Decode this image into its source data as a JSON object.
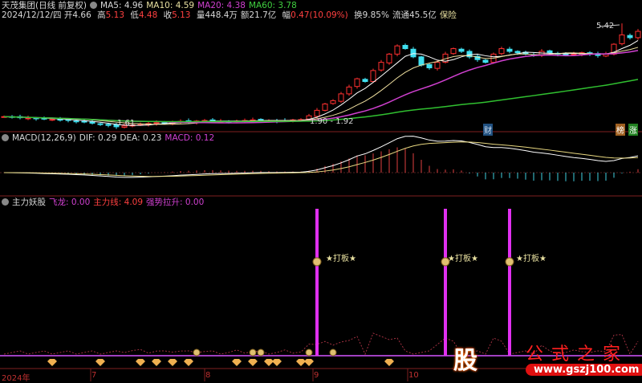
{
  "header": {
    "stock_name": "天茂集团(日线 前复权)",
    "ma5": "MA5: 4.96",
    "ma10": "MA10: 4.59",
    "ma20": "MA20: 4.38",
    "ma60": "MA60: 3.78",
    "date": "2024/12/12/四",
    "open_label": "开",
    "open": "4.66",
    "high_label": "高",
    "high": "5.13",
    "low_label": "低",
    "low": "4.48",
    "close_label": "收",
    "close": "5.13",
    "volume": "量448.4万",
    "amount": "额21.7亿",
    "change_label": "幅",
    "change": "0.47(10.09%)",
    "turnover": "换9.85%",
    "float": "流通45.5亿",
    "sector": "保险"
  },
  "macd_header": {
    "name": "MACD(12,26,9)",
    "dif": "DIF: 0.29",
    "dea": "DEA: 0.23",
    "macd": "MACD: 0.12"
  },
  "ind_header": {
    "name": "主力妖股",
    "feilong": "飞龙: 0.00",
    "zhuli": "主力线: 4.09",
    "qiangshi": "强势拉升: 0.00"
  },
  "labels": {
    "low_price": "1.61",
    "range": "1.90 - 1.92",
    "high_price": "5.42",
    "cai": "财",
    "bang": "榜",
    "zhang": "涨",
    "signal": "★打板★"
  },
  "xaxis": [
    "2024年",
    "7",
    "8",
    "9",
    "10"
  ],
  "logo": {
    "gu": "股",
    "name": "公式之家",
    "url": "www.gszj100.com"
  },
  "colors": {
    "up": "#ff3030",
    "down": "#40e0f0",
    "ma5": "#ffffff",
    "ma10": "#f0e0a0",
    "ma20": "#d040d0",
    "ma60": "#30c030",
    "signal": "#e030f0"
  },
  "chart_data": {
    "type": "candlestick",
    "title": "天茂集团(日线 前复权)",
    "closes": [
      2.02,
      2.0,
      1.98,
      1.97,
      1.95,
      1.93,
      1.92,
      1.9,
      1.88,
      1.85,
      1.82,
      1.78,
      1.74,
      1.7,
      1.65,
      1.68,
      1.72,
      1.75,
      1.77,
      1.8,
      1.78,
      1.82,
      1.85,
      1.83,
      1.86,
      1.88,
      1.87,
      1.85,
      1.84,
      1.86,
      1.88,
      1.9,
      1.89,
      1.87,
      1.86,
      1.88,
      1.9,
      1.91,
      2.05,
      2.25,
      2.48,
      2.6,
      2.85,
      3.1,
      3.4,
      3.3,
      3.7,
      4.0,
      4.3,
      4.6,
      4.5,
      4.2,
      3.9,
      3.8,
      4.0,
      4.3,
      4.5,
      4.4,
      4.2,
      4.1,
      4.0,
      4.3,
      4.5,
      4.4,
      4.35,
      4.3,
      4.25,
      4.4,
      4.35,
      4.3,
      4.28,
      4.3,
      4.35,
      4.3,
      4.25,
      4.3,
      4.66,
      5.0,
      4.9,
      5.13
    ],
    "price_range": [
      1.5,
      5.6
    ],
    "moving_averages": [
      5,
      10,
      20,
      60
    ],
    "signal_bars": [
      39,
      55,
      63
    ],
    "diamond_bars": [
      6,
      12,
      17,
      19,
      21,
      23,
      29,
      31,
      33,
      34,
      37,
      38,
      48
    ],
    "moneybag_bars": [
      24,
      31,
      32,
      38,
      41
    ]
  }
}
